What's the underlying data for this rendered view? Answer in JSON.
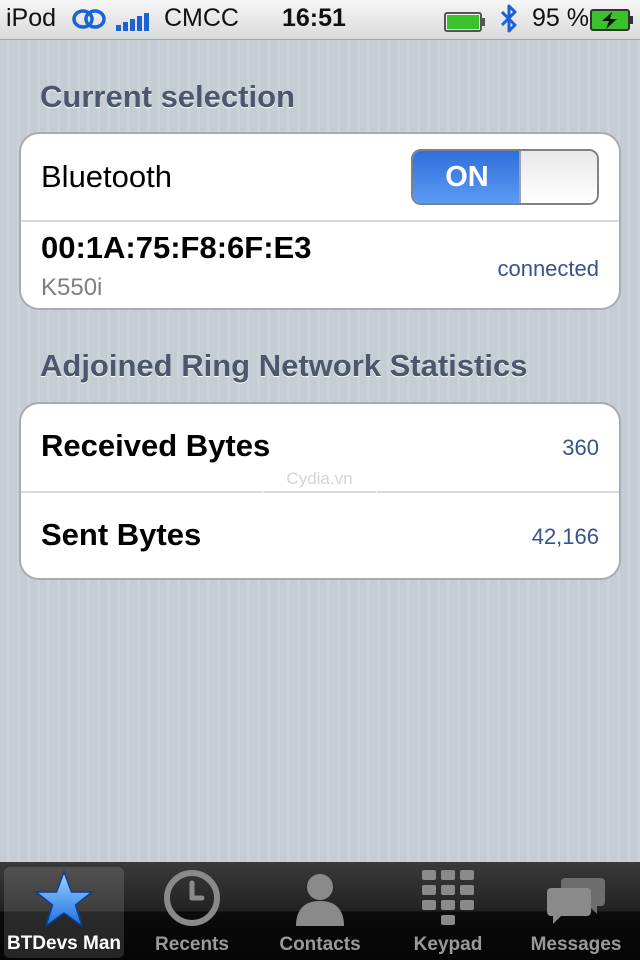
{
  "status_bar": {
    "device": "iPod",
    "carrier": "CMCC",
    "time": "16:51",
    "battery_percent": "95 %",
    "battery_level": 0.95
  },
  "sections": {
    "current_selection": {
      "header": "Current selection",
      "bluetooth_label": "Bluetooth",
      "toggle_state": "ON",
      "device_address": "00:1A:75:F8:6F:E3",
      "device_name": "K550i",
      "device_status": "connected"
    },
    "statistics": {
      "header": "Adjoined Ring Network Statistics",
      "rows": [
        {
          "label": "Received Bytes",
          "value": "360"
        },
        {
          "label": "Sent Bytes",
          "value": "42,166"
        }
      ]
    }
  },
  "watermark": "Cydia.vn",
  "tab_bar": {
    "tabs": [
      {
        "label": "BTDevs Man",
        "icon": "star-icon",
        "selected": true
      },
      {
        "label": "Recents",
        "icon": "clock-icon",
        "selected": false
      },
      {
        "label": "Contacts",
        "icon": "contact-icon",
        "selected": false
      },
      {
        "label": "Keypad",
        "icon": "keypad-icon",
        "selected": false
      },
      {
        "label": "Messages",
        "icon": "messages-icon",
        "selected": false
      }
    ]
  },
  "colors": {
    "accent_blue": "#2f6fdb",
    "value_text": "#38528c",
    "section_header": "#4c566c",
    "battery_green": "#39c22c"
  }
}
